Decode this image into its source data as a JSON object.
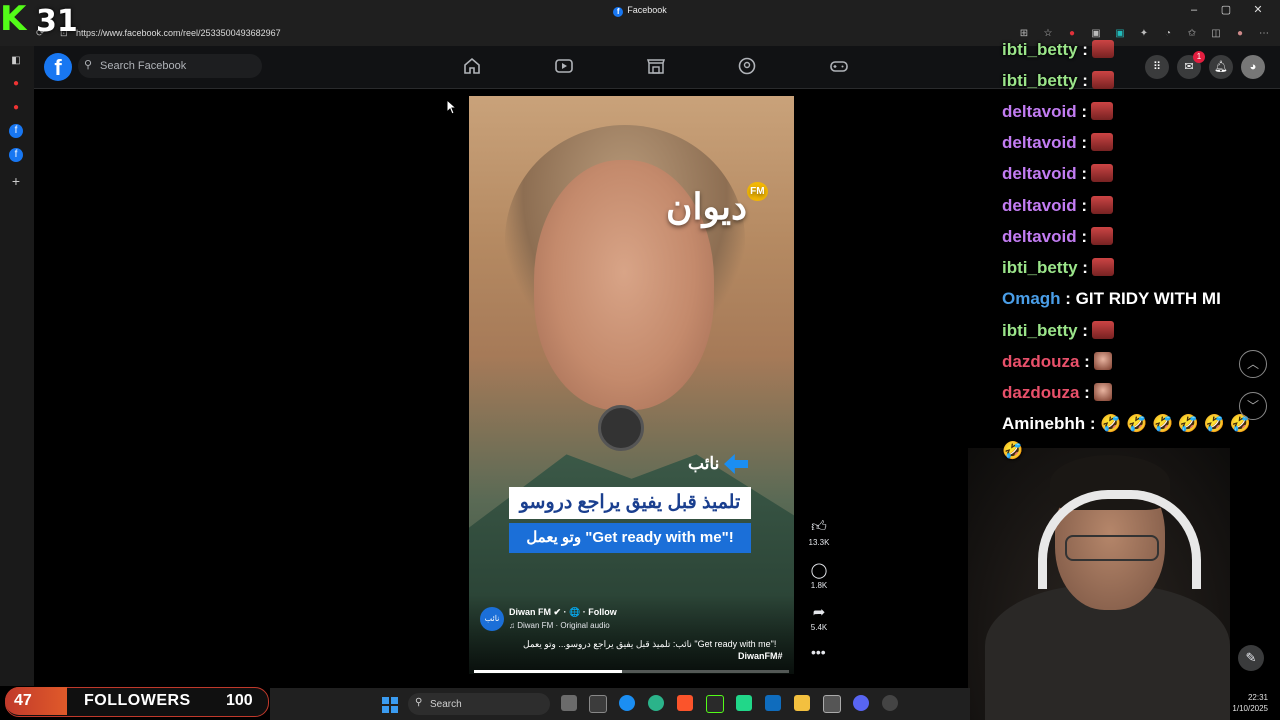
{
  "browser": {
    "tab_title": "Facebook",
    "url": "https://www.facebook.com/reel/2533500493682967",
    "window_controls": [
      "–",
      "▢",
      "✕"
    ]
  },
  "facebook": {
    "search_placeholder": "Search Facebook",
    "nav": [
      "home-icon",
      "video-icon",
      "marketplace-icon",
      "groups-icon",
      "gaming-icon"
    ],
    "messenger_badge": "1",
    "brand_color": "#1877f2"
  },
  "reel": {
    "overlay_logo": "ديوان",
    "overlay_logo_sub": "FM",
    "label_naib": "نائب",
    "caption_line1": "تلميذ قبل يفيق يراجع دروسو",
    "caption_line2": "وتو يعمل \"Get ready with me\"!",
    "page_name": "Diwan FM ✔ · 🌐 · Follow",
    "audio": "♫ Diwan FM · Original audio",
    "description": "نائب: تلميذ قبل يفيق يراجع دروسو... وتو يعمل \"Get ready with me\"!",
    "hashtag": "DiwanFM#",
    "likes": "13.3K",
    "comments": "1.8K",
    "shares": "5.4K",
    "progress_fraction": 0.47
  },
  "chat": [
    {
      "user": "ibti_betty",
      "color": "#9be58a",
      "emote": true
    },
    {
      "user": "ibti_betty",
      "color": "#9be58a",
      "emote": true
    },
    {
      "user": "deltavoid",
      "color": "#c27cf2",
      "emote": true
    },
    {
      "user": "deltavoid",
      "color": "#c27cf2",
      "emote": true
    },
    {
      "user": "deltavoid",
      "color": "#c27cf2",
      "emote": true
    },
    {
      "user": "deltavoid",
      "color": "#c27cf2",
      "emote": true
    },
    {
      "user": "deltavoid",
      "color": "#c27cf2",
      "emote": true
    },
    {
      "user": "ibti_betty",
      "color": "#9be58a",
      "emote": true
    },
    {
      "user": "Omagh",
      "color": "#4a9ee8",
      "message": "GIT RIDY WITH MI"
    },
    {
      "user": "ibti_betty",
      "color": "#9be58a",
      "emote": true
    },
    {
      "user": "dazdouza",
      "color": "#e8506a",
      "emote": "bald"
    },
    {
      "user": "dazdouza",
      "color": "#e8506a",
      "emote": "bald"
    },
    {
      "user": "Aminebhh",
      "color": "#ffffff",
      "message": "🤣 🤣 🤣 🤣 🤣 🤣"
    },
    {
      "user": "",
      "color": "#ffffff",
      "message": "🤣"
    }
  ],
  "stream": {
    "counter": "31",
    "followers_current": "47",
    "followers_label": "FOLLOWERS",
    "followers_goal": "100",
    "followers_progress_fraction": 0.47
  },
  "taskbar": {
    "search_label": "Search",
    "time": "22:31",
    "date": "1/10/2025"
  }
}
